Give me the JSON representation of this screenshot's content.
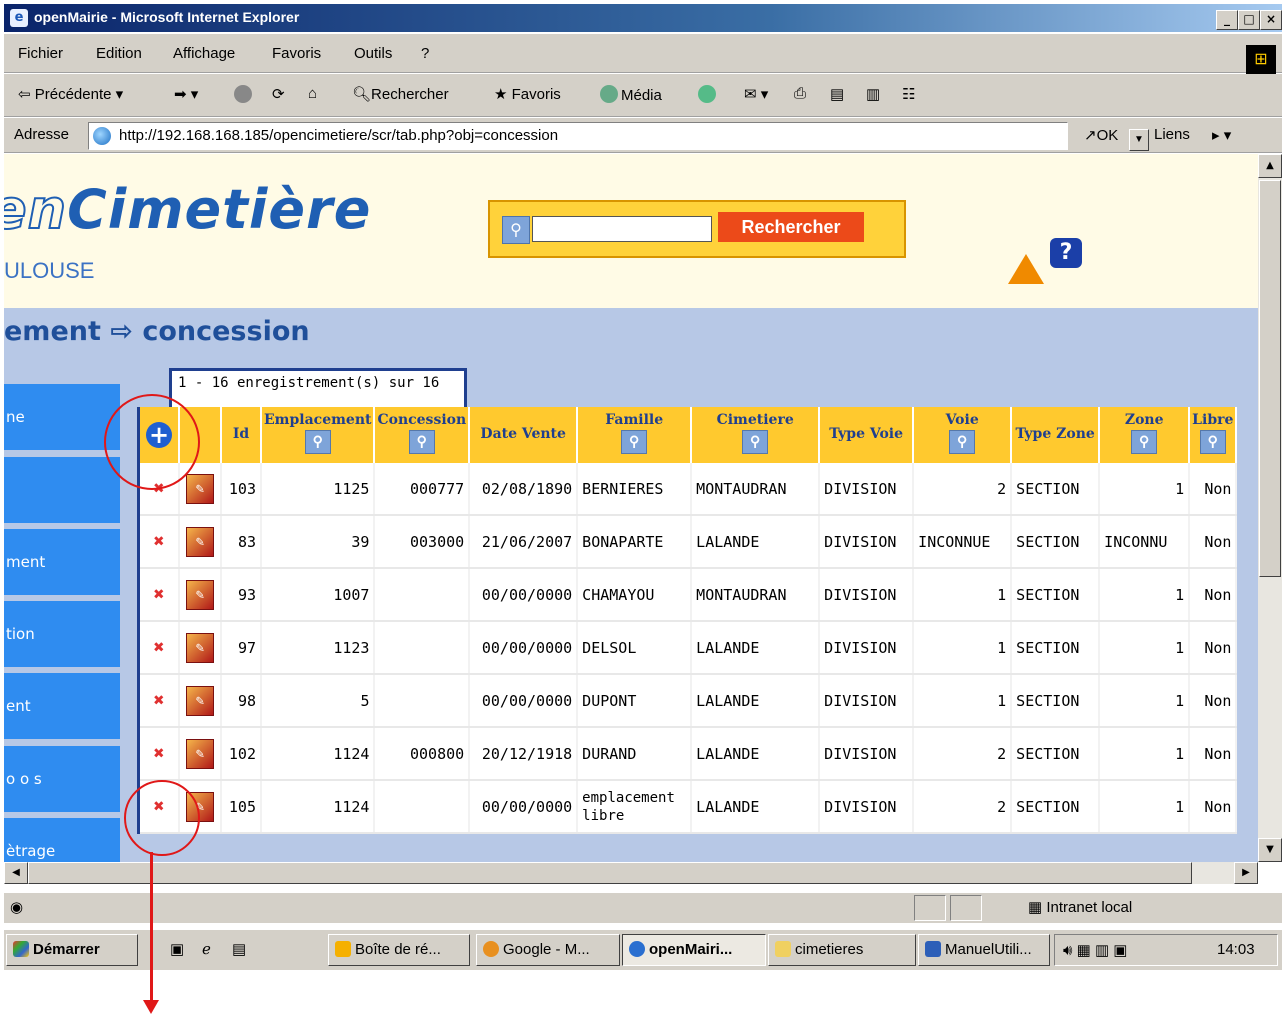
{
  "window": {
    "title": "openMairie - Microsoft Internet Explorer",
    "min": "_",
    "max": "□",
    "close": "×"
  },
  "menu": [
    "Fichier",
    "Edition",
    "Affichage",
    "Favoris",
    "Outils",
    "?"
  ],
  "toolbar": {
    "back": "Précédente",
    "search": "Rechercher",
    "favorites": "Favoris",
    "media": "Média"
  },
  "address": {
    "label": "Adresse",
    "url": "http://192.168.168.185/opencimetiere/scr/tab.php?obj=concession",
    "go": "OK",
    "links": "Liens"
  },
  "app": {
    "logo_outline": "en",
    "logo_text": "Cimetière",
    "city": "ULOUSE",
    "search_button": "Rechercher",
    "help": "?",
    "breadcrumb_left": "ement",
    "breadcrumb_arrow": "⇨",
    "breadcrumb_right": "concession",
    "record_count": "1 - 16 enregistrement(s) sur 16"
  },
  "sidebar": [
    "ne",
    "",
    "ment",
    "tion",
    "ent",
    "o o s",
    "ètrage"
  ],
  "table": {
    "headers": [
      "Id",
      "Emplacement",
      "Concession",
      "Date Vente",
      "Famille",
      "Cimetiere",
      "Type Voie",
      "Voie",
      "Type Zone",
      "Zone",
      "Libre"
    ],
    "rows": [
      [
        "103",
        "1125",
        "000777",
        "02/08/1890",
        "BERNIERES",
        "MONTAUDRAN",
        "DIVISION",
        "2",
        "SECTION",
        "1",
        "Non"
      ],
      [
        "83",
        "39",
        "003000",
        "21/06/2007",
        "BONAPARTE",
        "LALANDE",
        "DIVISION",
        "INCONNUE",
        "SECTION",
        "INCONNU",
        "Non"
      ],
      [
        "93",
        "1007",
        "",
        "00/00/0000",
        "CHAMAYOU",
        "MONTAUDRAN",
        "DIVISION",
        "1",
        "SECTION",
        "1",
        "Non"
      ],
      [
        "97",
        "1123",
        "",
        "00/00/0000",
        "DELSOL",
        "LALANDE",
        "DIVISION",
        "1",
        "SECTION",
        "1",
        "Non"
      ],
      [
        "98",
        "5",
        "",
        "00/00/0000",
        "DUPONT",
        "LALANDE",
        "DIVISION",
        "1",
        "SECTION",
        "1",
        "Non"
      ],
      [
        "102",
        "1124",
        "000800",
        "20/12/1918",
        "DURAND",
        "LALANDE",
        "DIVISION",
        "2",
        "SECTION",
        "1",
        "Non"
      ],
      [
        "105",
        "1124",
        "",
        "00/00/0000",
        "emplacement libre",
        "LALANDE",
        "DIVISION",
        "2",
        "SECTION",
        "1",
        "Non"
      ]
    ]
  },
  "status": {
    "zone": "Intranet local"
  },
  "taskbar": {
    "start": "Démarrer",
    "tasks": [
      "Boîte de ré...",
      "Google - M...",
      "openMairi...",
      "cimetieres",
      "ManuelUtili..."
    ],
    "clock": "14:03"
  },
  "colors": {
    "accent_blue": "#1f5fb3",
    "header_yellow": "#ffc92e",
    "search_red": "#ec4a19",
    "annotation_red": "#e01818"
  }
}
